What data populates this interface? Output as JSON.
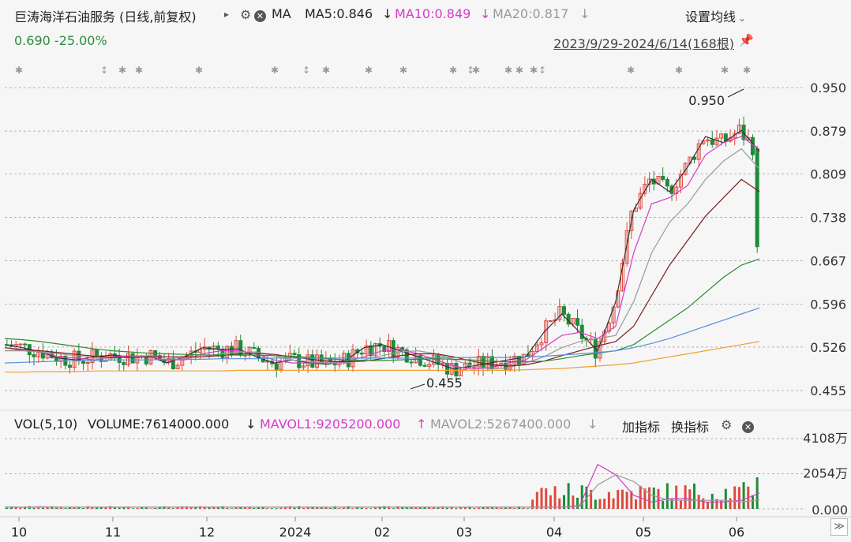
{
  "header": {
    "title": "巨涛海洋石油服务 (日线,前复权)",
    "play_glyph": "▸",
    "ma_label": "MA",
    "ma5": "MA5:0.846",
    "ma10": "MA10:0.849",
    "ma20": "MA20:0.817",
    "down_arrow": "↓",
    "settings_label": "设置均线",
    "settings_chevron": "⌄",
    "change_text": "0.690 -25.00%",
    "range_text": "2023/9/29-2024/6/14(168根)"
  },
  "volume_header": {
    "vol_label": "VOL(5,10)",
    "volume": "VOLUME:7614000.000",
    "down_arrow": "↓",
    "up_arrow": "↑",
    "mavol1": "MAVOL1:9205200.000",
    "mavol2": "MAVOL2:5267400.000",
    "add_indicator": "加指标",
    "switch_indicator": "换指标"
  },
  "annotations": {
    "high": "0.950",
    "low": "0.455"
  },
  "colors": {
    "up": "#e0483e",
    "down": "#1f8b3a",
    "ma5": "#333333",
    "ma10": "#d63cc8",
    "ma20": "#9a9a9a",
    "ma30": "#7a1c1c",
    "ma60": "#2f8a2f",
    "ma120": "#5b8fd6",
    "ma250": "#f0a030"
  },
  "chart_data": [
    {
      "type": "candlestick",
      "title": "巨涛海洋石油服务 (日线,前复权)",
      "date_range": "2023/9/29-2024/6/14",
      "bar_count": 168,
      "y_ticks": [
        "0.950",
        "0.879",
        "0.809",
        "0.738",
        "0.667",
        "0.596",
        "0.526",
        "0.455"
      ],
      "ylim": [
        0.44,
        0.96
      ],
      "x_ticks": [
        "10",
        "11",
        "12",
        "2024",
        "02",
        "03",
        "04",
        "05",
        "06"
      ],
      "last": {
        "open": 0.85,
        "high": 0.855,
        "low": 0.68,
        "close": 0.69,
        "change_pct": -25.0
      },
      "ma_current": {
        "MA5": 0.846,
        "MA10": 0.849,
        "MA20": 0.817
      },
      "annotations": [
        {
          "label": "0.950",
          "value": 0.95,
          "kind": "high"
        },
        {
          "label": "0.455",
          "value": 0.455,
          "kind": "low"
        }
      ],
      "series": [
        {
          "name": "MA5",
          "values": [
            0.53,
            0.525,
            0.518,
            0.508,
            0.505,
            0.51,
            0.513,
            0.51,
            0.512,
            0.5,
            0.51,
            0.525,
            0.522,
            0.523,
            0.51,
            0.5,
            0.505,
            0.5,
            0.498,
            0.505,
            0.525,
            0.53,
            0.52,
            0.51,
            0.5,
            0.49,
            0.495,
            0.5,
            0.505,
            0.51,
            0.55,
            0.58,
            0.55,
            0.52,
            0.6,
            0.75,
            0.8,
            0.78,
            0.82,
            0.87,
            0.86,
            0.88,
            0.846
          ]
        },
        {
          "name": "MA10",
          "values": [
            0.52,
            0.522,
            0.518,
            0.51,
            0.508,
            0.505,
            0.51,
            0.512,
            0.51,
            0.505,
            0.505,
            0.515,
            0.52,
            0.52,
            0.515,
            0.505,
            0.5,
            0.5,
            0.5,
            0.502,
            0.51,
            0.52,
            0.522,
            0.515,
            0.505,
            0.495,
            0.49,
            0.492,
            0.5,
            0.505,
            0.525,
            0.545,
            0.55,
            0.54,
            0.56,
            0.68,
            0.76,
            0.77,
            0.79,
            0.84,
            0.86,
            0.87,
            0.849
          ]
        },
        {
          "name": "MA20",
          "values": [
            0.52,
            0.52,
            0.518,
            0.515,
            0.512,
            0.508,
            0.508,
            0.51,
            0.512,
            0.51,
            0.508,
            0.51,
            0.515,
            0.518,
            0.518,
            0.512,
            0.505,
            0.502,
            0.5,
            0.5,
            0.505,
            0.512,
            0.518,
            0.52,
            0.515,
            0.505,
            0.495,
            0.49,
            0.492,
            0.5,
            0.51,
            0.525,
            0.535,
            0.54,
            0.545,
            0.6,
            0.68,
            0.73,
            0.76,
            0.8,
            0.83,
            0.85,
            0.817
          ]
        },
        {
          "name": "MA30",
          "values": [
            0.525,
            0.522,
            0.52,
            0.517,
            0.514,
            0.511,
            0.509,
            0.509,
            0.51,
            0.51,
            0.51,
            0.51,
            0.512,
            0.515,
            0.516,
            0.514,
            0.51,
            0.506,
            0.503,
            0.502,
            0.503,
            0.507,
            0.512,
            0.515,
            0.515,
            0.51,
            0.503,
            0.497,
            0.495,
            0.497,
            0.503,
            0.512,
            0.52,
            0.528,
            0.535,
            0.56,
            0.61,
            0.66,
            0.7,
            0.74,
            0.77,
            0.8,
            0.78
          ]
        },
        {
          "name": "MA60",
          "values": [
            0.54,
            0.538,
            0.535,
            0.531,
            0.527,
            0.523,
            0.52,
            0.518,
            0.516,
            0.515,
            0.514,
            0.513,
            0.513,
            0.513,
            0.513,
            0.512,
            0.511,
            0.509,
            0.507,
            0.505,
            0.504,
            0.504,
            0.505,
            0.506,
            0.507,
            0.506,
            0.505,
            0.503,
            0.502,
            0.502,
            0.503,
            0.507,
            0.512,
            0.516,
            0.52,
            0.53,
            0.55,
            0.57,
            0.59,
            0.615,
            0.64,
            0.66,
            0.67
          ]
        },
        {
          "name": "MA120",
          "values": [
            0.5,
            0.501,
            0.502,
            0.503,
            0.504,
            0.504,
            0.505,
            0.505,
            0.505,
            0.506,
            0.506,
            0.506,
            0.507,
            0.507,
            0.507,
            0.508,
            0.508,
            0.508,
            0.508,
            0.508,
            0.508,
            0.508,
            0.508,
            0.508,
            0.509,
            0.509,
            0.509,
            0.509,
            0.509,
            0.51,
            0.511,
            0.513,
            0.515,
            0.517,
            0.52,
            0.525,
            0.532,
            0.54,
            0.55,
            0.56,
            0.57,
            0.58,
            0.59
          ]
        },
        {
          "name": "MA250",
          "values": [
            0.485,
            0.485,
            0.486,
            0.486,
            0.486,
            0.487,
            0.487,
            0.487,
            0.487,
            0.487,
            0.487,
            0.487,
            0.487,
            0.488,
            0.488,
            0.488,
            0.488,
            0.488,
            0.488,
            0.488,
            0.488,
            0.488,
            0.488,
            0.488,
            0.488,
            0.488,
            0.488,
            0.488,
            0.488,
            0.489,
            0.49,
            0.491,
            0.493,
            0.495,
            0.497,
            0.5,
            0.505,
            0.51,
            0.515,
            0.52,
            0.525,
            0.53,
            0.535
          ]
        }
      ]
    },
    {
      "type": "bar",
      "title": "VOL(5,10)",
      "y_ticks": [
        "4108万",
        "2054万",
        "0.000"
      ],
      "ylim": [
        0,
        41080000
      ],
      "current": {
        "VOLUME": 7614000,
        "MAVOL1": 9205200,
        "MAVOL2": 5267400
      }
    }
  ]
}
